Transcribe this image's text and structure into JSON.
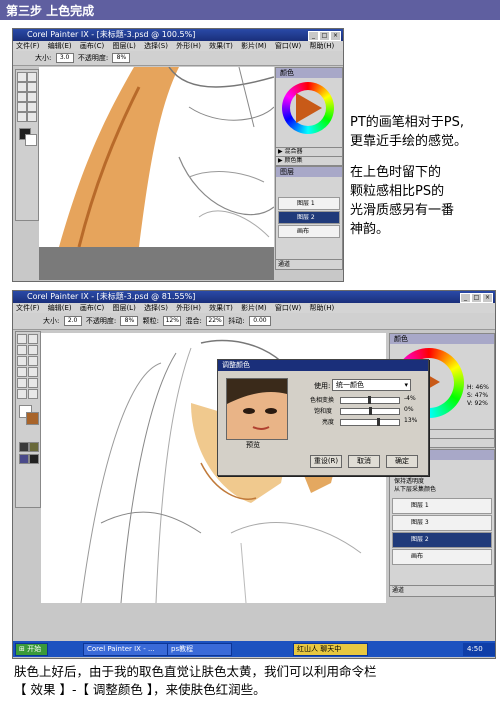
{
  "header": {
    "title": "第三步 上色完成"
  },
  "shot1": {
    "window_title": "Corel Painter IX - [未标题-3.psd @ 100.5%]",
    "menu": [
      "文件(F)",
      "编辑(E)",
      "画布(C)",
      "图层(L)",
      "选择(S)",
      "外形(H)",
      "效果(T)",
      "影片(M)",
      "窗口(W)",
      "帮助(H)"
    ],
    "props": {
      "size_label": "大小:",
      "size_value": "3.0",
      "opacity_label": "不透明度:",
      "opacity_value": "8%"
    },
    "color_panel_title": "颜色",
    "panel_labels": [
      "▶ 混合器",
      "▶ 颜色集"
    ],
    "layers_title": "图层",
    "layers": [
      "图层 1",
      "图层 2",
      "画布"
    ],
    "channels_title": "通道"
  },
  "side_text": {
    "line1": "PT的画笔相对于PS,",
    "line2": "更靠近手绘的感觉。",
    "line3": "在上色时留下的",
    "line4": "颗粒感相比PS的",
    "line5": "光滑质感另有一番",
    "line6": "神韵。"
  },
  "shot2": {
    "window_title": "Corel Painter IX - [未标题-3.psd @ 81.55%]",
    "menu": [
      "文件(F)",
      "编辑(E)",
      "画布(C)",
      "图层(L)",
      "选择(S)",
      "外形(H)",
      "效果(T)",
      "影片(M)",
      "窗口(W)",
      "帮助(H)"
    ],
    "props": {
      "size_label": "大小:",
      "size_value": "2.0",
      "opacity_label": "不透明度:",
      "opacity_value": "8%",
      "grain_label": "颗粒:",
      "grain_value": "12%",
      "resat_label": "混合:",
      "resat_value": "22%",
      "jitter_label": "抖动:",
      "jitter_value": "0.00"
    },
    "color_panel_title": "颜色",
    "hsv": {
      "h": "H: 46%",
      "s": "S: 47%",
      "v": "V: 92%"
    },
    "panel_labels": [
      "▶ 混合器",
      "▶ 颜色集"
    ],
    "layers_title": "图层",
    "layers_opts": [
      "保持透明度",
      "从下层采集颜色"
    ],
    "layers": [
      "图层 1",
      "图层 3",
      "图层 2",
      "画布"
    ],
    "channels_title": "通道",
    "dialog": {
      "title": "调整颜色",
      "use_label": "使用:",
      "use_value": "统一颜色",
      "hue_label": "色相变换",
      "hue_value": "-4%",
      "sat_label": "饱和度",
      "sat_value": "0%",
      "val_label": "亮度",
      "val_value": "13%",
      "preview_label": "预览",
      "reset": "重设(R)",
      "cancel": "取消",
      "ok": "确定"
    },
    "taskbar": {
      "start": "开始",
      "items": [
        "Corel Painter IX - ...",
        "ps教程"
      ],
      "input_method": "红山人 聊天中",
      "clock": "4:50"
    }
  },
  "bottom_text": {
    "line1": "肤色上好后，由于我的取色直觉让肤色太黄，我们可以利用命令栏",
    "line2": "【 效果 】-【 调整颜色 】，来使肤色红润些。"
  },
  "colors": {
    "header_bg": "#5f5fa0",
    "accent_blue": "#1a2f7a",
    "skin": "#e8a868"
  }
}
